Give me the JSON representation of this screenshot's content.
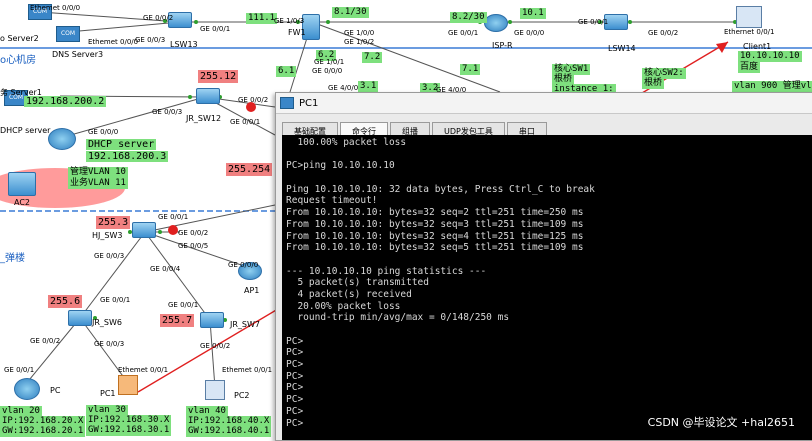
{
  "labels": {
    "server2_name": "o Server2",
    "server2_port": "Ethemet 0/0/0",
    "dns_port": "Ethemet 0/0/0",
    "dns_name": "DNS Server3",
    "lsw13_port_a": "GE 0/0/2",
    "lsw13_port_b": "GE 0/0/3",
    "lsw13_port_c": "GE 0/0/1",
    "lsw13_name": "LSW13",
    "ip_111": "111.1",
    "fw1_port_a": "GE 1/0/3",
    "fw1_name": "FW1",
    "fw1_port_b": "GE 1/0/0",
    "fw1_port_c": "GE 1/0/2",
    "ip_81": "8.1/30",
    "ip_82": "8.2/30",
    "ip_101": "10.1",
    "isp_port_a": "GE 0/0/1",
    "isp_port_b": "GE 0/0/0",
    "isp_name": "ISP-R",
    "lsw14_port_a": "GE 0/0/1",
    "lsw14_port_b": "GE 0/0/2",
    "lsw14_name": "LSW14",
    "client1_port": "Ethernet 0/0/1",
    "client1_name": "Client1",
    "client1_ip": "10.10.10.10",
    "baidu": "百度",
    "room_label": "o心机房",
    "server1_label": "务 Server1",
    "server1_ip": "192.168.200.2",
    "ip_6_2": "6.2",
    "ip_7_2": "7.2",
    "ip_6_1": "6.1",
    "ip_3_1": "3.1",
    "ip_3_2": "3.2",
    "ip_7_1": "7.1",
    "port_ge110": "GE 1/0/1",
    "port_ge000": "GE 0/0/0",
    "port_ge400": "GE 4/0/0",
    "port_ge4000": "GE 4/0/0",
    "core_sw1_title": "核心SW1",
    "core_sw1_line2": "根桥",
    "core_sw1_line3": "instance 1:",
    "core_sw2_title": "核心SW2:",
    "core_sw2_line2": "根桥",
    "ip_255_12": "255.12",
    "jr_sw12_port_a": "GE 0/0/2",
    "jr_sw12_port_b": "GE 0/0/3",
    "jr_sw12_name": "JR_SW12",
    "jr_sw12_port_c": "GE 0/0/1",
    "dhcp_label_left": "DHCP server",
    "dhcp_port": "GE 0/0/0",
    "dhcp_box_title": "DHCP server",
    "dhcp_box_ip": "192.168.200.3",
    "mgmt_vlan": "管理VLAN 10",
    "biz_vlan": "业务VLAN 11",
    "ac2_name": "AC2",
    "ip_255_254": "255.254",
    "ip_255_3": "255.3",
    "hj_sw3_port_a": "GE 0/0/1",
    "hj_sw3_port_b": "GE 0/0/2",
    "hj_sw3_name": "HJ_SW3",
    "hj_sw3_port_c": "GE 0/0/5",
    "hj_sw3_port_d": "GE 0/0/3",
    "hj_sw3_port_e": "GE 0/0/4",
    "building_label": "_弹楼",
    "ap1_port": "GE 0/0/0",
    "ap1_name": "AP1",
    "ip_255_6": "255.6",
    "jr_sw6_port_a": "GE 0/0/1",
    "jr_sw6_name": "JR_SW6",
    "jr_sw6_port_b": "GE 0/0/2",
    "jr_sw6_port_c": "GE 0/0/3",
    "ip_255_7": "255.7",
    "jr_sw7_port_a": "GE 0/0/1",
    "jr_sw7_name": "JR_SW7",
    "jr_sw7_port_b": "GE 0/0/2",
    "pc_left_port": "GE 0/0/1",
    "pc_left_name": "PC",
    "pc1_port": "Ethemet 0/0/1",
    "pc1_name": "PC1",
    "pc2_port": "Ethemet 0/0/1",
    "pc2_name": "PC2",
    "vlan20": "vlan 20",
    "vlan20_ip": "IP:192.168.20.X",
    "vlan20_gw": "GW:192.168.20.1",
    "vlan30": "vlan 30",
    "vlan30_ip": "IP:192.168.30.X",
    "vlan30_gw": "GW:192.168.30.1",
    "vlan40": "vlan 40",
    "vlan40_ip": "IP:192.168.40.X",
    "vlan40_gw": "GW:192.168.40.1",
    "vlan900": "vlan 900 管理vlan"
  },
  "window": {
    "title": "PC1",
    "tabs": [
      "基础配置",
      "命令行",
      "组播",
      "UDP发包工具",
      "串口"
    ],
    "active_tab": 1
  },
  "console_lines": [
    "  100.00% packet loss",
    "",
    "PC>ping 10.10.10.10",
    "",
    "Ping 10.10.10.10: 32 data bytes, Press Ctrl_C to break",
    "Request timeout!",
    "From 10.10.10.10: bytes=32 seq=2 ttl=251 time=250 ms",
    "From 10.10.10.10: bytes=32 seq=3 ttl=251 time=109 ms",
    "From 10.10.10.10: bytes=32 seq=4 ttl=251 time=125 ms",
    "From 10.10.10.10: bytes=32 seq=5 ttl=251 time=109 ms",
    "",
    "--- 10.10.10.10 ping statistics ---",
    "  5 packet(s) transmitted",
    "  4 packet(s) received",
    "  20.00% packet loss",
    "  round-trip min/avg/max = 0/148/250 ms",
    "",
    "PC>",
    "PC>",
    "PC>",
    "PC>",
    "PC>",
    "PC>",
    "PC>",
    "PC>"
  ],
  "watermark": "CSDN @毕设论文 +hal2651",
  "colors": {
    "link_green": "#2e9e2e",
    "label_green": "#7ee07e",
    "label_red": "#f08080",
    "arrow_red": "#e02020",
    "area_blue": "#3a7bd5",
    "console_bg": "#000000"
  }
}
